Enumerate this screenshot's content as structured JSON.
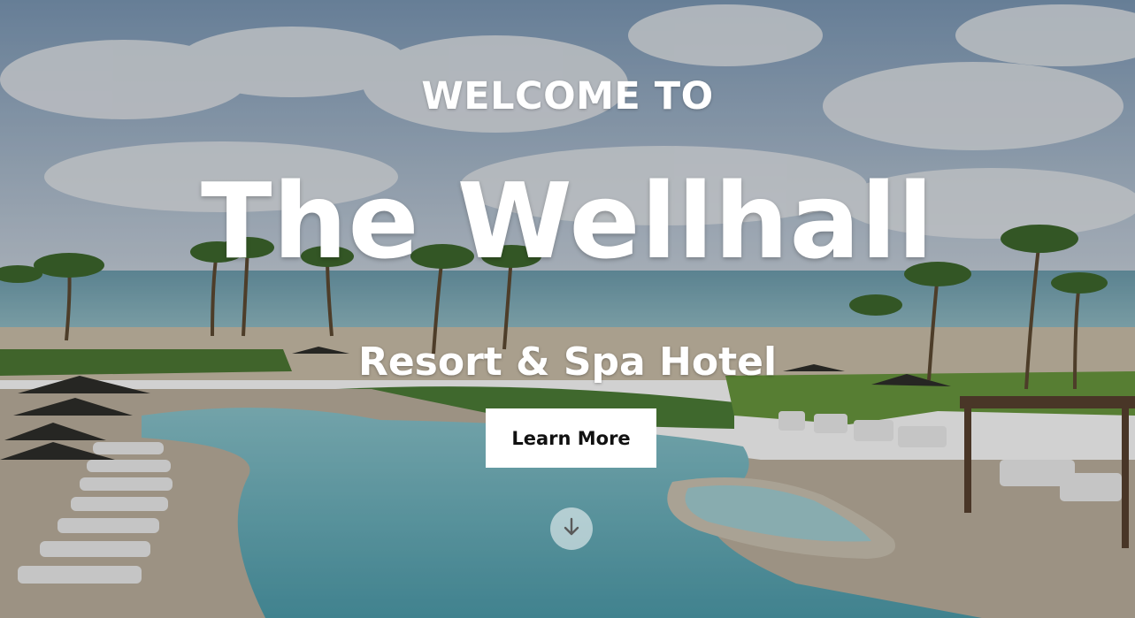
{
  "hero": {
    "welcome": "WELCOME TO",
    "title": "The Wellhall",
    "subtitle": "Resort & Spa Hotel",
    "cta_label": "Learn More",
    "scroll_icon": "arrow-down-icon"
  },
  "colors": {
    "text": "#ffffff",
    "button_bg": "#ffffff",
    "button_text": "#111111",
    "sky": "#8aa7c7",
    "sea": "#7fb7c2",
    "pool": "#6fb6c2",
    "lawn": "#5c8a3a"
  }
}
